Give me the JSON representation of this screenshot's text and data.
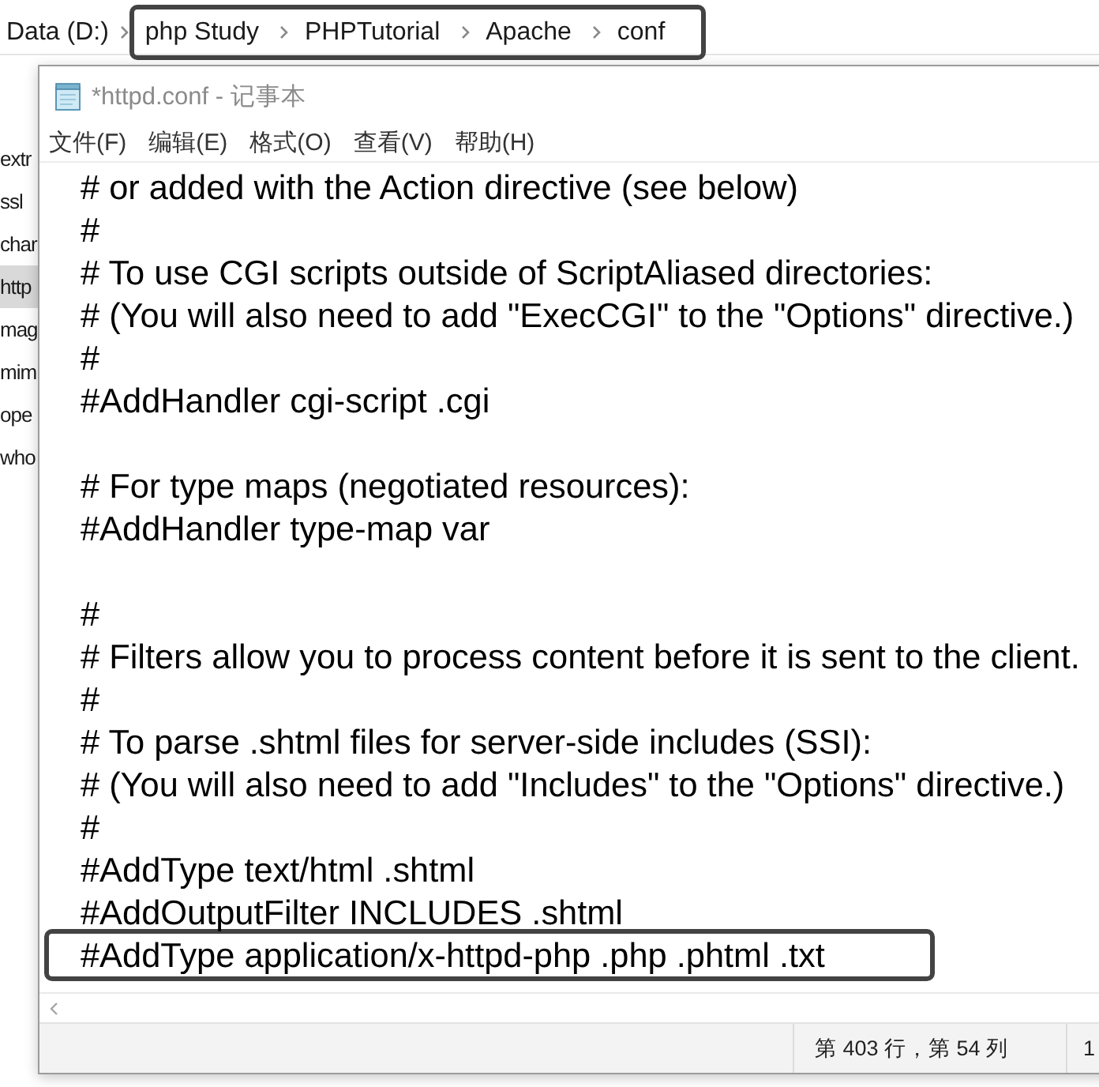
{
  "explorer": {
    "breadcrumb": [
      {
        "label": "Data (D:)",
        "boxed": false
      },
      {
        "label": "php Study",
        "boxed": true
      },
      {
        "label": "PHPTutorial",
        "boxed": true
      },
      {
        "label": "Apache",
        "boxed": true
      },
      {
        "label": "conf",
        "boxed": true
      }
    ],
    "files": [
      {
        "label": "extr",
        "selected": false
      },
      {
        "label": "ssl",
        "selected": false
      },
      {
        "label": "char",
        "selected": false
      },
      {
        "label": "http",
        "selected": true
      },
      {
        "label": "mag",
        "selected": false
      },
      {
        "label": "mim",
        "selected": false
      },
      {
        "label": "ope",
        "selected": false
      },
      {
        "label": "who",
        "selected": false
      }
    ]
  },
  "notepad": {
    "title": "*httpd.conf - 记事本",
    "menu": [
      "文件(F)",
      "编辑(E)",
      "格式(O)",
      "查看(V)",
      "帮助(H)"
    ],
    "lines": [
      {
        "kind": "text",
        "text": "# or added with the Action directive (see below)",
        "boxed": false
      },
      {
        "kind": "text",
        "text": "#",
        "boxed": false
      },
      {
        "kind": "text",
        "text": "# To use CGI scripts outside of ScriptAliased directories:",
        "boxed": false
      },
      {
        "kind": "text",
        "text": "# (You will also need to add \"ExecCGI\" to the \"Options\" directive.)",
        "boxed": false
      },
      {
        "kind": "text",
        "text": "#",
        "boxed": false
      },
      {
        "kind": "text",
        "text": "#AddHandler cgi-script .cgi",
        "boxed": false
      },
      {
        "kind": "blank"
      },
      {
        "kind": "text",
        "text": "# For type maps (negotiated resources):",
        "boxed": false
      },
      {
        "kind": "text",
        "text": "#AddHandler type-map var",
        "boxed": false
      },
      {
        "kind": "blank"
      },
      {
        "kind": "text",
        "text": "#",
        "boxed": false
      },
      {
        "kind": "text",
        "text": "# Filters allow you to process content before it is sent to the client.",
        "boxed": false
      },
      {
        "kind": "text",
        "text": "#",
        "boxed": false
      },
      {
        "kind": "text",
        "text": "# To parse .shtml files for server-side includes (SSI):",
        "boxed": false
      },
      {
        "kind": "text",
        "text": "# (You will also need to add \"Includes\" to the \"Options\" directive.)",
        "boxed": false
      },
      {
        "kind": "text",
        "text": "#",
        "boxed": false
      },
      {
        "kind": "text",
        "text": "#AddType text/html .shtml",
        "boxed": false
      },
      {
        "kind": "text",
        "text": "#AddOutputFilter INCLUDES .shtml",
        "boxed": false
      },
      {
        "kind": "text",
        "text": "#AddType application/x-httpd-php .php .phtml .txt",
        "boxed": true
      }
    ],
    "status_bar": {
      "cells": [
        "第 403 行，第 54 列",
        "1"
      ]
    }
  }
}
